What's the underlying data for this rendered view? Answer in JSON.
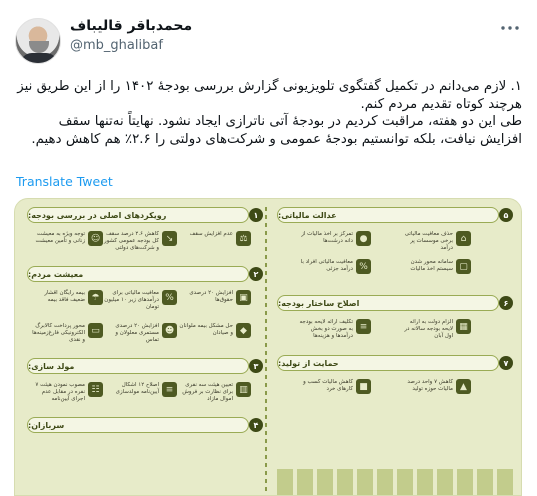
{
  "author": {
    "name": "محمدباقر قالیباف",
    "handle": "@mb_ghalibaf"
  },
  "tweet": {
    "paragraph1": "۱. لازم می‌دانم در تکمیل گفتگوی تلویزیونی  گزارش بررسی بودجهٔ ۱۴۰۲ را از این طریق نیز هرچند کوتاه تقدیم مردم کنم.",
    "paragraph2": "طی این دو هفته، مراقبت کردیم در بودجهٔ آتی ناترازی ایجاد نشود. نهایتاً نه‌تنها سقف افزایش نیافت، بلکه توانستیم بودجهٔ عمومی و شرکت‌های دولتی  را ۲.۶٪ هم کاهش دهیم.",
    "translate_label": "Translate Tweet"
  },
  "infographic": {
    "left_sections": [
      {
        "num": "۱",
        "title": "رویکردهای اصلی در بررسی بودجه:",
        "items": [
          {
            "text": "عدم افزایش سقف",
            "icon": "balance-icon"
          },
          {
            "text": "کاهش ۲.۶ درصد سقف کل بودجه عمومی کشور و شرکت‌های دولتی",
            "icon": "chart-down-icon"
          },
          {
            "text": "توجه ویژه به معیشت زنانی و تأمین معیشت",
            "icon": "family-icon"
          }
        ]
      },
      {
        "num": "۲",
        "title": "معیشت مردم:",
        "items": [
          {
            "text": "افزایش ۲۰ درصدی حقوق‌ها",
            "icon": "wallet-icon"
          },
          {
            "text": "معافیت مالیاتی برای درآمدهای زیر ۱۰ میلیون تومان",
            "icon": "percent-icon"
          },
          {
            "text": "بیمه رایگان اقشار ضعیف فاقد بیمه",
            "icon": "umbrella-icon"
          },
          {
            "text": "حل مشکل بیمه ملوانان و صیادان",
            "icon": "shield-icon"
          },
          {
            "text": "افزایش ۲۰ درصدی مستمری معلولان و تماس",
            "icon": "people-icon"
          },
          {
            "text": "محور پرداخت کالابرگ الکترونیکی فارغ‌زمینه‌ها و نقدی",
            "icon": "card-icon"
          }
        ]
      },
      {
        "num": "۳",
        "title": "مولد سازی:",
        "items": [
          {
            "text": "تعیین هیئت سه نفری برای نظارت بر فروش اموال مازاد",
            "icon": "building-icon"
          },
          {
            "text": "اصلاح ۱۲ اشکال آیین‌نامه مولدسازی",
            "icon": "document-icon"
          },
          {
            "text": "مصوب نمودن هیئت ۷ نفره در مقابل عدم اجرای آیین‌نامه",
            "icon": "group-icon"
          }
        ]
      },
      {
        "num": "۴",
        "title": "سربازان:",
        "items": []
      }
    ],
    "right_sections": [
      {
        "num": "۵",
        "title": "عدالت مالیاتی:",
        "items": [
          {
            "text": "حذف معافیت مالیاتی برخی موسسات پر درآمد",
            "icon": "bank-icon"
          },
          {
            "text": "تمرکز بر اخذ مالیات از دانه درشت‌ها",
            "icon": "coins-icon"
          },
          {
            "text": "سامانه محور شدن سیستم اخذ مالیات",
            "icon": "monitor-icon"
          },
          {
            "text": "معافیت مالیاتی افراد با درآمد جزئی",
            "icon": "percent-icon"
          }
        ]
      },
      {
        "num": "۶",
        "title": "اصلاح ساختار بودجه:",
        "items": [
          {
            "text": "الزام دولت به ارائه لایحه بودجه سالانه در اول آبان",
            "icon": "calendar-icon"
          },
          {
            "text": "تکلیف ارائه لایحه بودجه به صورت دو بخش درآمدها و هزینه‌ها",
            "icon": "document-icon"
          }
        ]
      },
      {
        "num": "۷",
        "title": "حمایت از تولید:",
        "items": [
          {
            "text": "کاهش ۷ واحد درصد مالیات حوزه تولید",
            "icon": "factory-icon"
          },
          {
            "text": "کاهش مالیات کسب و کارهای خرد",
            "icon": "shop-icon"
          }
        ]
      }
    ]
  }
}
